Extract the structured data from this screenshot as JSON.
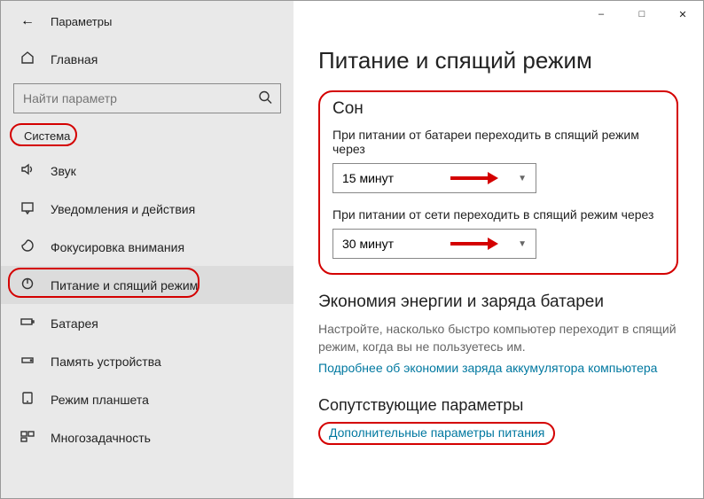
{
  "app_title": "Параметры",
  "home_label": "Главная",
  "search_placeholder": "Найти параметр",
  "category": "Система",
  "nav": {
    "sound": "Звук",
    "notifications": "Уведомления и действия",
    "focus": "Фокусировка внимания",
    "power": "Питание и спящий режим",
    "battery": "Батарея",
    "storage": "Память устройства",
    "tablet": "Режим планшета",
    "multitask": "Многозадачность"
  },
  "main": {
    "title": "Питание и спящий режим",
    "sleep_heading": "Сон",
    "battery_sleep_label": "При питании от батареи переходить в спящий режим через",
    "battery_sleep_value": "15 минут",
    "plugged_sleep_label": "При питании от сети переходить в спящий режим через",
    "plugged_sleep_value": "30 минут",
    "economy_heading": "Экономия энергии и заряда батареи",
    "economy_desc": "Настройте, насколько быстро компьютер переходит в спящий режим, когда вы не пользуетесь им.",
    "economy_link": "Подробнее об экономии заряда аккумулятора компьютера",
    "related_heading": "Сопутствующие параметры",
    "related_link": "Дополнительные параметры питания"
  }
}
